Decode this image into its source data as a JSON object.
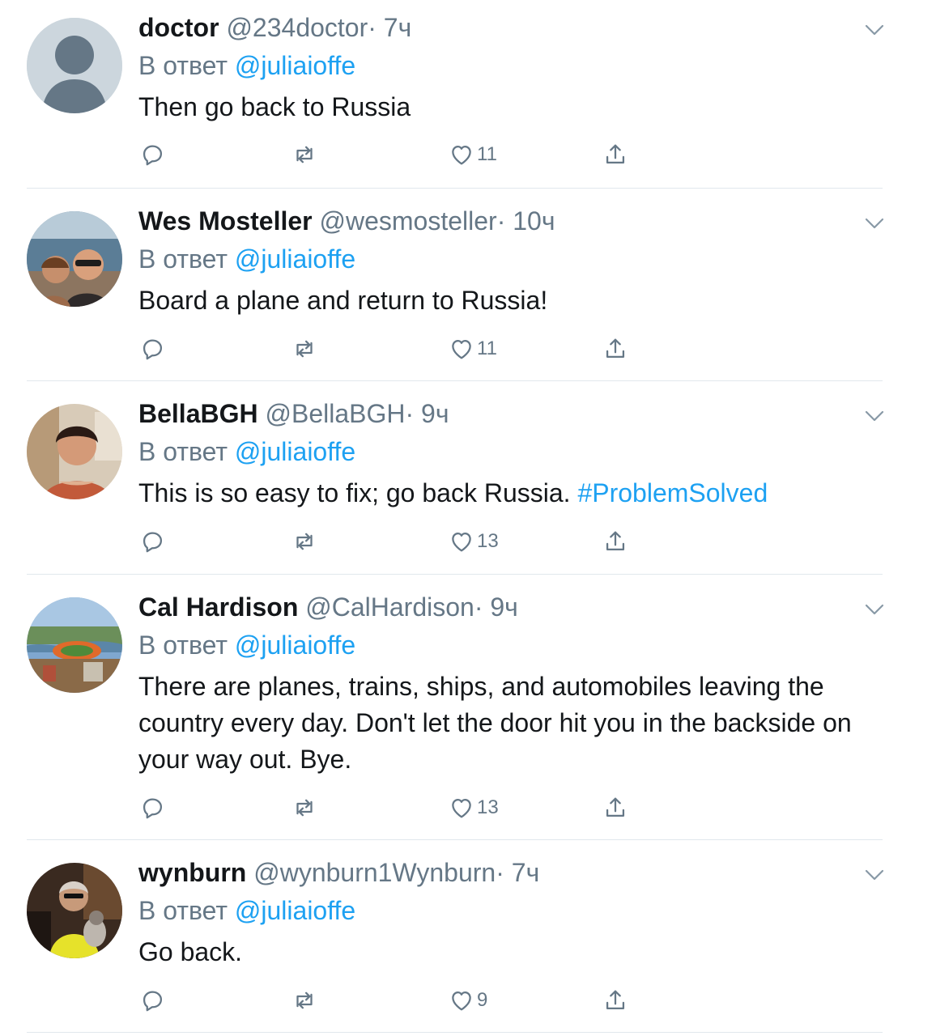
{
  "reply_label": "В ответ",
  "reply_to": "@juliaioffe",
  "colors": {
    "link": "#1da1f2",
    "secondary": "#657786",
    "divider": "#e1e8ed"
  },
  "icons": {
    "reply": "comment-icon",
    "retweet": "retweet-icon",
    "like": "heart-icon",
    "share": "share-icon",
    "menu": "chevron-down-icon"
  },
  "tweets": [
    {
      "name": "doctor",
      "handle": "@234doctor",
      "time": "· 7ч",
      "text": "Then go back to Russia",
      "hashtag": "",
      "likes": "11"
    },
    {
      "name": "Wes Mosteller",
      "handle": "@wesmosteller",
      "time": "· 10ч",
      "text": "Board a plane and return to Russia!",
      "hashtag": "",
      "likes": "11"
    },
    {
      "name": "BellaBGH",
      "handle": "@BellaBGH",
      "time": "· 9ч",
      "text": "This is so easy to fix; go back Russia. ",
      "hashtag": "#ProblemSolved",
      "likes": "13"
    },
    {
      "name": "Cal Hardison",
      "handle": "@CalHardison",
      "time": "· 9ч",
      "text": "There are planes, trains, ships, and automobiles leaving the country every day. Don't let the door hit you in the backside on your way out. Bye.",
      "hashtag": "",
      "likes": "13"
    },
    {
      "name": "wynburn",
      "handle": "@wynburn1Wynburn",
      "time": "· 7ч",
      "text": "Go back.",
      "hashtag": "",
      "likes": "9"
    }
  ]
}
